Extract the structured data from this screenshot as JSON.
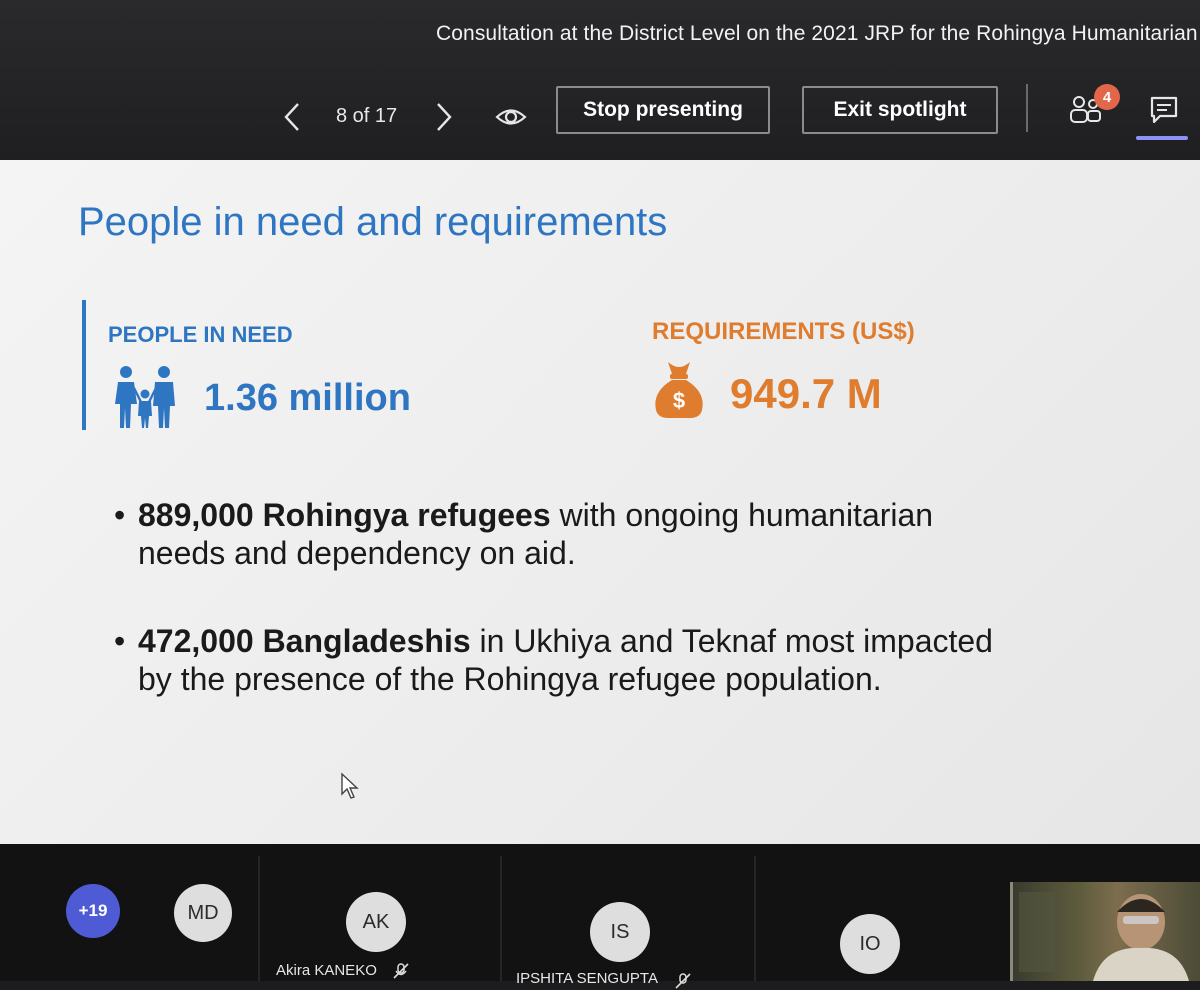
{
  "meeting": {
    "title": "Consultation at the District Level on the 2021 JRP for the Rohingya Humanitarian"
  },
  "controls": {
    "slide_counter": "8 of 17",
    "stop_presenting_label": "Stop presenting",
    "exit_spotlight_label": "Exit spotlight",
    "participants_badge": "4"
  },
  "slide": {
    "title": "People in need and requirements",
    "people_in_need": {
      "label": "PEOPLE IN NEED",
      "value": "1.36 million"
    },
    "requirements": {
      "label": "REQUIREMENTS (US$)",
      "value": "949.7 M",
      "currency_symbol": "$"
    },
    "bullets": [
      {
        "bold": "889,000 Rohingya refugees",
        "rest_line1": " with ongoing humanitarian",
        "rest_line2": "needs and dependency on aid."
      },
      {
        "bold": "472,000 Bangladeshis",
        "rest_line1": " in Ukhiya and Teknaf most impacted",
        "rest_line2": "by the presence of the Rohingya refugee population."
      }
    ],
    "colors": {
      "blue": "#2f76c2",
      "orange": "#e07c2e"
    }
  },
  "participants": {
    "more_count": "+19",
    "tiles": [
      {
        "initials": "MD"
      },
      {
        "initials": "AK",
        "name": "Akira KANEKO"
      },
      {
        "initials": "IS",
        "name": "IPSHITA SENGUPTA"
      },
      {
        "initials": "IO"
      }
    ]
  }
}
